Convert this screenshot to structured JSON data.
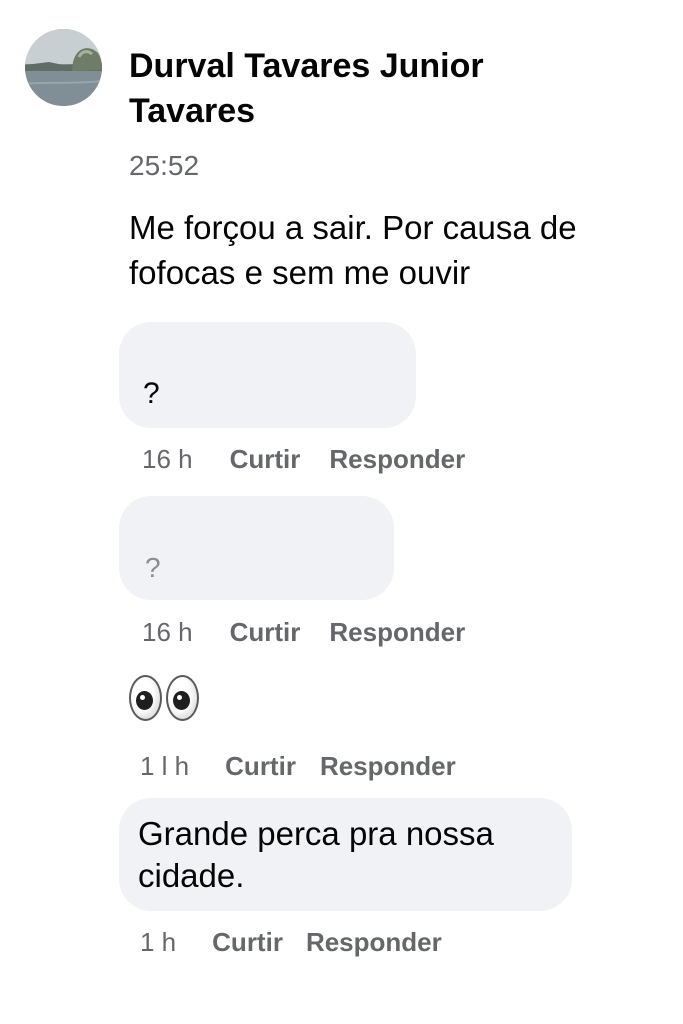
{
  "post": {
    "author": "Durval Tavares Junior Tavares",
    "timestamp": "25:52",
    "text": "Me forçou a sair. Por causa de fofocas e sem me ouvir"
  },
  "comments": [
    {
      "text": "?",
      "time": "16 h",
      "like_label": "Curtir",
      "reply_label": "Responder"
    },
    {
      "text": "?",
      "time": "16 h",
      "like_label": "Curtir",
      "reply_label": "Responder"
    },
    {
      "emoji_icon": "eyes-icon",
      "time": "1 l h",
      "like_label": "Curtir",
      "reply_label": "Responder"
    },
    {
      "text": "Grande perca pra nossa cidade.",
      "time": "1 h",
      "like_label": "Curtir",
      "reply_label": "Responder"
    }
  ],
  "colors": {
    "bubble_background": "#f0f2f5",
    "secondary_text": "#65676b",
    "primary_text": "#050505"
  }
}
